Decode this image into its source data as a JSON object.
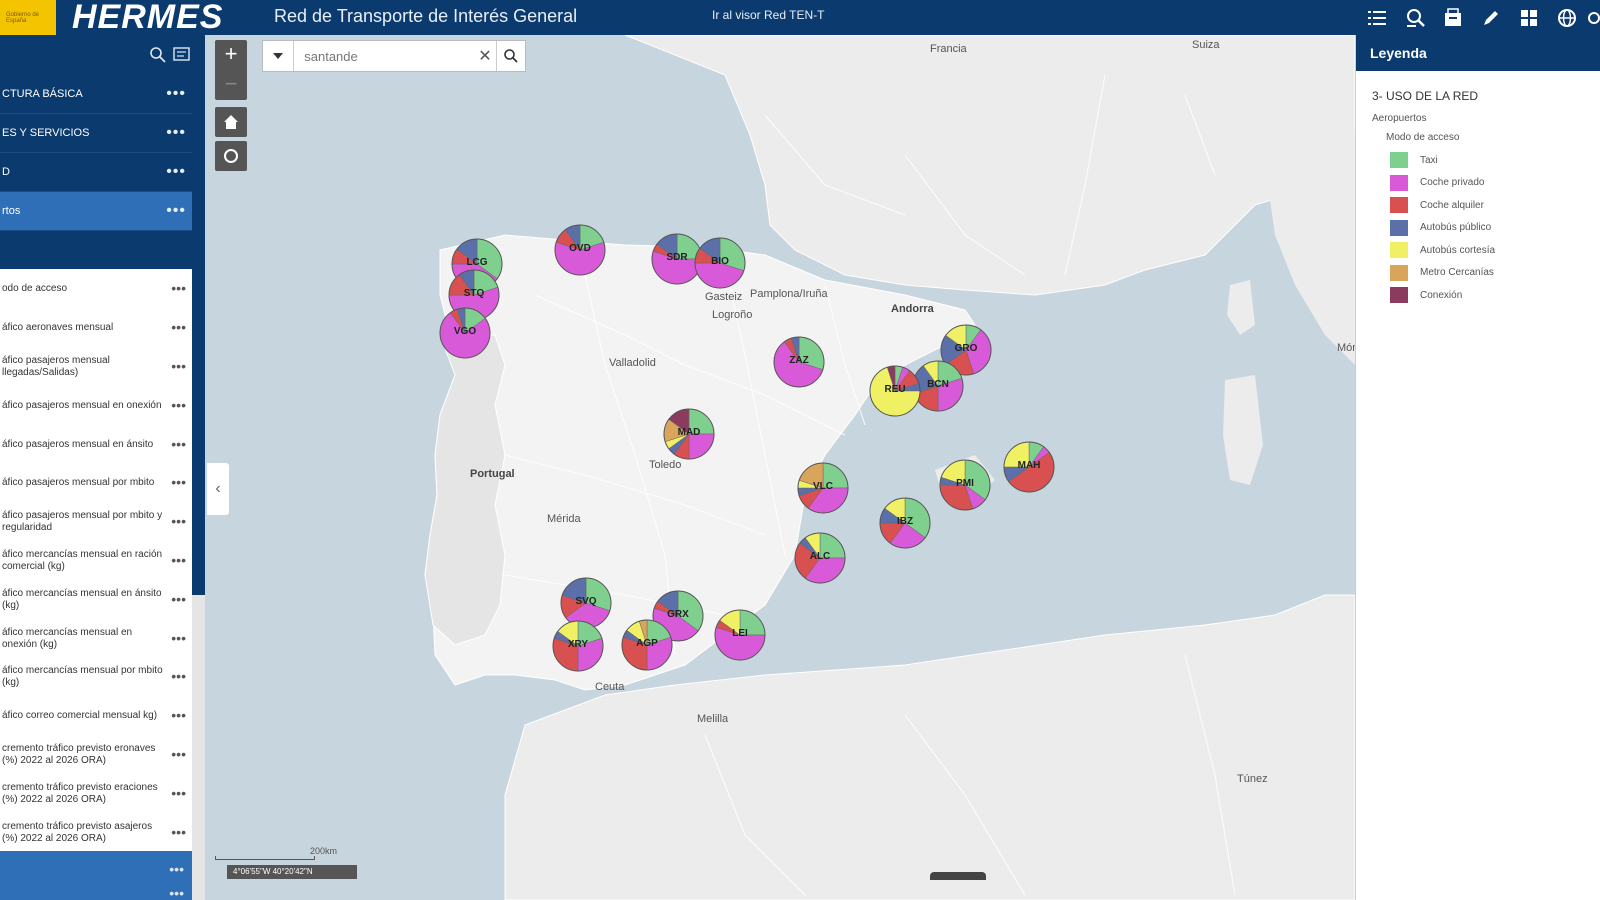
{
  "header": {
    "logo_text": "Gobierno de España",
    "brand": "HERMES",
    "title": "Red de Transporte de Interés General",
    "ten_link": "Ir al visor Red TEN-T"
  },
  "toolbar_icons": [
    "list-icon",
    "query-icon",
    "layers-icon",
    "pencil-icon",
    "grid-icon",
    "globe-icon"
  ],
  "sidebar": {
    "top_items": [
      {
        "label": "CTURA BÁSICA"
      },
      {
        "label": "ES Y SERVICIOS"
      },
      {
        "label": "D"
      },
      {
        "label": "rtos"
      }
    ],
    "panel_items": [
      {
        "label": "odo de acceso"
      },
      {
        "label": "áfico aeronaves mensual"
      },
      {
        "label": "áfico pasajeros mensual llegadas/Salidas)"
      },
      {
        "label": "áfico pasajeros mensual en onexión"
      },
      {
        "label": "áfico pasajeros mensual en ánsito"
      },
      {
        "label": "áfico pasajeros mensual por mbito"
      },
      {
        "label": "áfico pasajeros mensual por mbito y regularidad"
      },
      {
        "label": "áfico mercancías mensual en ración comercial (kg)"
      },
      {
        "label": "áfico mercancías mensual en ánsito (kg)"
      },
      {
        "label": "áfico mercancías mensual en onexión (kg)"
      },
      {
        "label": "áfico mercancías mensual por mbito (kg)"
      },
      {
        "label": "áfico correo comercial mensual kg)"
      },
      {
        "label": "cremento tráfico previsto eronaves (%) 2022 al 2026 ORA)"
      },
      {
        "label": "cremento tráfico previsto eraciones (%) 2022 al 2026 ORA)"
      },
      {
        "label": "cremento tráfico previsto asajeros (%) 2022 al 2026 ORA)"
      }
    ]
  },
  "map": {
    "search_value": "santande",
    "scale_label": "200km",
    "coords": "4°06'55\"W 40°20'42\"N",
    "places": [
      {
        "name": "Francia",
        "bold": false
      },
      {
        "name": "Suiza",
        "bold": false
      },
      {
        "name": "Mónaco",
        "bold": false
      },
      {
        "name": "Andorra",
        "bold": true
      },
      {
        "name": "Portugal",
        "bold": true
      },
      {
        "name": "Pamplona/Iruña",
        "bold": false
      },
      {
        "name": "Gasteiz",
        "bold": false
      },
      {
        "name": "Logroño",
        "bold": false
      },
      {
        "name": "Valladolid",
        "bold": false
      },
      {
        "name": "Toledo",
        "bold": false
      },
      {
        "name": "Mérida",
        "bold": false
      },
      {
        "name": "Ceuta",
        "bold": false
      },
      {
        "name": "Melilla",
        "bold": false
      },
      {
        "name": "Túnez",
        "bold": false
      }
    ],
    "airports": [
      {
        "code": "LCG",
        "slices": [
          0.35,
          0.4,
          0.1,
          0.15,
          0,
          0,
          0
        ]
      },
      {
        "code": "STQ",
        "slices": [
          0.2,
          0.55,
          0.15,
          0.1,
          0,
          0,
          0
        ]
      },
      {
        "code": "VGO",
        "slices": [
          0.15,
          0.75,
          0.05,
          0.05,
          0,
          0,
          0
        ]
      },
      {
        "code": "OVD",
        "slices": [
          0.2,
          0.6,
          0.1,
          0.1,
          0,
          0,
          0
        ]
      },
      {
        "code": "SDR",
        "slices": [
          0.25,
          0.55,
          0.05,
          0.15,
          0,
          0,
          0
        ]
      },
      {
        "code": "BIO",
        "slices": [
          0.3,
          0.45,
          0.1,
          0.15,
          0,
          0,
          0
        ]
      },
      {
        "code": "ZAZ",
        "slices": [
          0.3,
          0.6,
          0.05,
          0.05,
          0,
          0,
          0
        ]
      },
      {
        "code": "GRO",
        "slices": [
          0.1,
          0.35,
          0.2,
          0.2,
          0.15,
          0,
          0
        ]
      },
      {
        "code": "BCN",
        "slices": [
          0.2,
          0.3,
          0.2,
          0.2,
          0.1,
          0,
          0
        ]
      },
      {
        "code": "REU",
        "slices": [
          0.05,
          0.05,
          0.1,
          0.05,
          0.7,
          0,
          0.05
        ]
      },
      {
        "code": "MAD",
        "slices": [
          0.25,
          0.25,
          0.1,
          0.05,
          0.05,
          0.15,
          0.15
        ]
      },
      {
        "code": "VLC",
        "slices": [
          0.25,
          0.35,
          0.1,
          0.05,
          0.05,
          0.2,
          0
        ]
      },
      {
        "code": "IBZ",
        "slices": [
          0.35,
          0.25,
          0.15,
          0.1,
          0.15,
          0,
          0
        ]
      },
      {
        "code": "PMI",
        "slices": [
          0.35,
          0.1,
          0.3,
          0.05,
          0.2,
          0,
          0
        ]
      },
      {
        "code": "MAH",
        "slices": [
          0.1,
          0.05,
          0.5,
          0.1,
          0.25,
          0,
          0
        ]
      },
      {
        "code": "ALC",
        "slices": [
          0.25,
          0.35,
          0.25,
          0.05,
          0.1,
          0,
          0
        ]
      },
      {
        "code": "SVQ",
        "slices": [
          0.3,
          0.35,
          0.15,
          0.2,
          0,
          0,
          0
        ]
      },
      {
        "code": "GRX",
        "slices": [
          0.35,
          0.45,
          0.05,
          0.15,
          0,
          0,
          0
        ]
      },
      {
        "code": "XRY",
        "slices": [
          0.2,
          0.3,
          0.3,
          0.05,
          0.15,
          0,
          0
        ]
      },
      {
        "code": "AGP",
        "slices": [
          0.2,
          0.3,
          0.3,
          0.05,
          0.1,
          0.05,
          0
        ]
      },
      {
        "code": "LEI",
        "slices": [
          0.25,
          0.55,
          0.05,
          0,
          0.15,
          0,
          0
        ]
      }
    ]
  },
  "legend": {
    "header": "Leyenda",
    "section": "3- USO DE LA RED",
    "group": "Aeropuertos",
    "subgroup": "Modo de acceso",
    "items": [
      {
        "label": "Taxi",
        "color": "#7fd08e"
      },
      {
        "label": "Coche privado",
        "color": "#d95ad9"
      },
      {
        "label": "Coche alquiler",
        "color": "#d95050"
      },
      {
        "label": "Autobús público",
        "color": "#5b6fa8"
      },
      {
        "label": "Autobús cortesía",
        "color": "#f0f064"
      },
      {
        "label": "Metro Cercanías",
        "color": "#d9a55a"
      },
      {
        "label": "Conexión",
        "color": "#8a3b5e"
      }
    ]
  }
}
